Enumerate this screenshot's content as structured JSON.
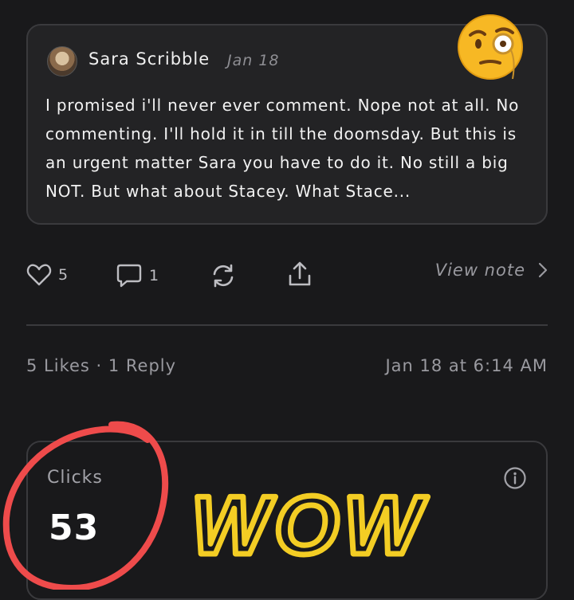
{
  "note": {
    "author": "Sara Scribble",
    "date": "Jan 18",
    "text": "I promised i'll never ever comment. Nope not at all. No commenting. I'll hold it in till the doomsday. But this is an urgent matter Sara you have to do it. No still a big NOT. But what about Stacey. What Stace...",
    "emoji_icon": "face-with-monocle-icon"
  },
  "actions": {
    "like_count": "5",
    "reply_count": "1",
    "view_note_label": "View note"
  },
  "stats": {
    "summary": "5 Likes · 1 Reply",
    "timestamp": "Jan 18 at 6:14 AM"
  },
  "clicks": {
    "label": "Clicks",
    "value": "53"
  },
  "annotation": {
    "circle_color": "#ee4b4b",
    "scribble_color": "#f3cd24",
    "scribble_text": "WOW"
  },
  "colors": {
    "background": "#19191b",
    "card": "#232325",
    "border": "#3a3a3d",
    "muted_text": "#9a9aa0"
  }
}
